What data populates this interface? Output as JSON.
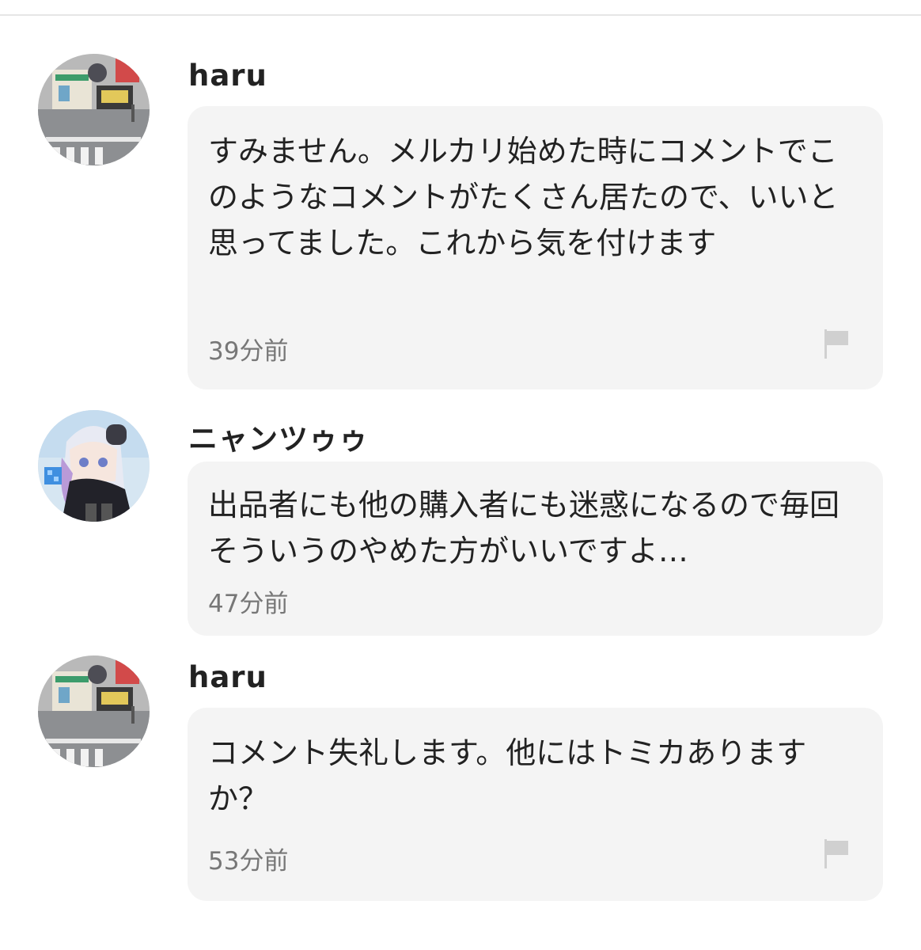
{
  "comments": [
    {
      "username": "haru",
      "avatar_icon": "avatar-street-diorama-icon",
      "text": "すみません。メルカリ始めた時にコメントでこのようなコメントがたくさん居たので、いいと思ってました。これから気を付けます",
      "time": "39分前",
      "has_flag": true
    },
    {
      "username": "ニャンツゥゥ",
      "avatar_icon": "avatar-anime-girl-icon",
      "text": "出品者にも他の購入者にも迷惑になるので毎回そういうのやめた方がいいですよ…",
      "time": "47分前",
      "has_flag": false
    },
    {
      "username": "haru",
      "avatar_icon": "avatar-street-diorama-icon",
      "text": "コメント失礼します。他にはトミカありますか？",
      "time": "53分前",
      "has_flag": true
    }
  ],
  "icons": {
    "flag": "flag-icon"
  },
  "colors": {
    "bubble_background": "#f4f4f4",
    "timestamp_text": "#777777",
    "flag": "#d0d0d0"
  }
}
